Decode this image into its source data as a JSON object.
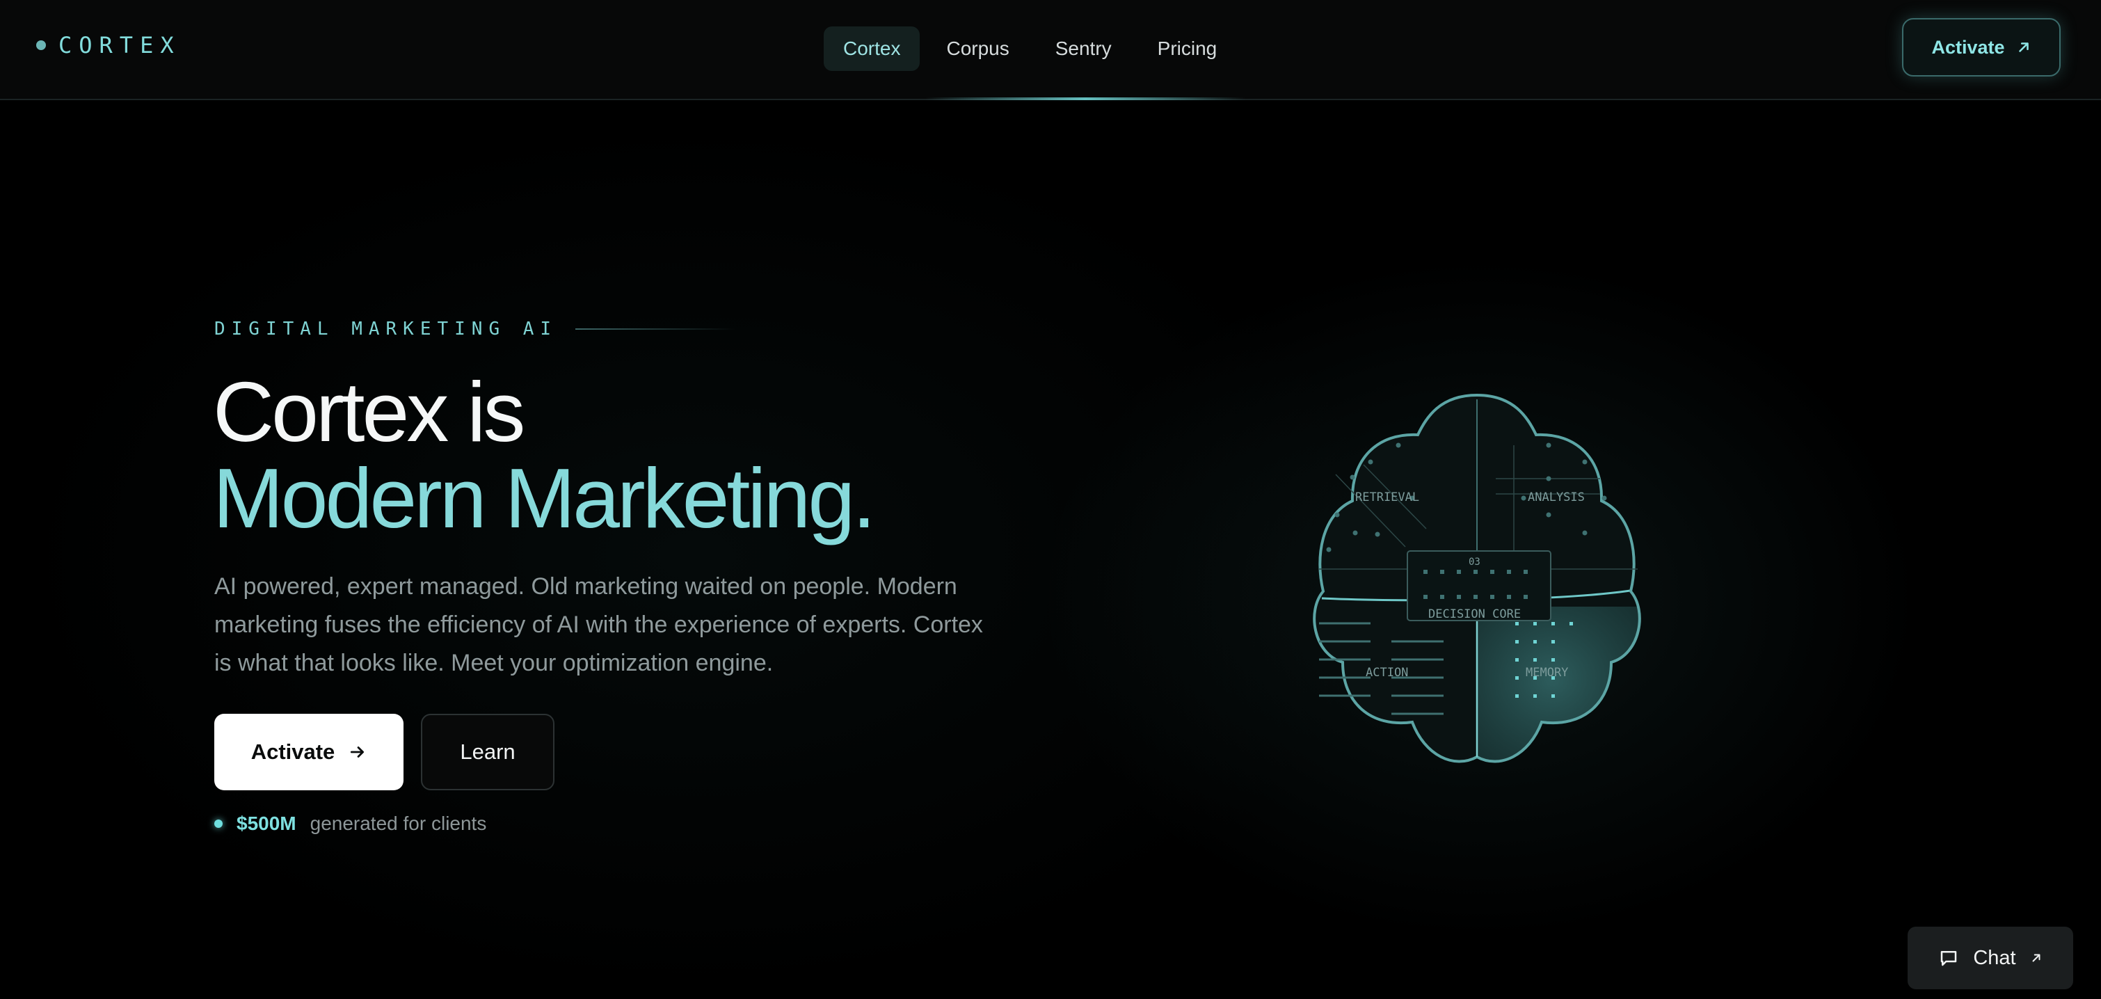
{
  "brand": {
    "name": "CORTEX"
  },
  "nav": {
    "tabs": [
      {
        "label": "Cortex",
        "active": true
      },
      {
        "label": "Corpus",
        "active": false
      },
      {
        "label": "Sentry",
        "active": false
      },
      {
        "label": "Pricing",
        "active": false
      }
    ]
  },
  "header": {
    "cta_label": "Activate"
  },
  "hero": {
    "eyebrow": "DIGITAL MARKETING AI",
    "headline_line1": "Cortex is",
    "headline_line2": "Modern Marketing.",
    "description": "AI powered, expert managed. Old marketing waited on people. Modern marketing fuses the efficiency of AI with the experience of experts. Cortex is what that looks like. Meet your optimization engine.",
    "primary_button": "Activate",
    "secondary_button": "Learn",
    "stat_value": "$500M",
    "stat_label": "generated for clients"
  },
  "diagram": {
    "quadrant_retrieval": "RETRIEVAL",
    "quadrant_analysis": "ANALYSIS",
    "quadrant_action": "ACTION",
    "quadrant_memory": "MEMORY",
    "core_label": "DECISION CORE",
    "core_index": "03"
  },
  "chat": {
    "label": "Chat"
  },
  "colors": {
    "accent": "#86d9da",
    "background": "#000000",
    "primary_button_bg": "#ffffff"
  },
  "icons": {
    "brand": "status-dot",
    "header_cta": "arrow-up-right-icon",
    "primary_button": "arrow-right-icon",
    "chat": "message-square-icon",
    "chat_cta": "arrow-up-right-icon"
  }
}
